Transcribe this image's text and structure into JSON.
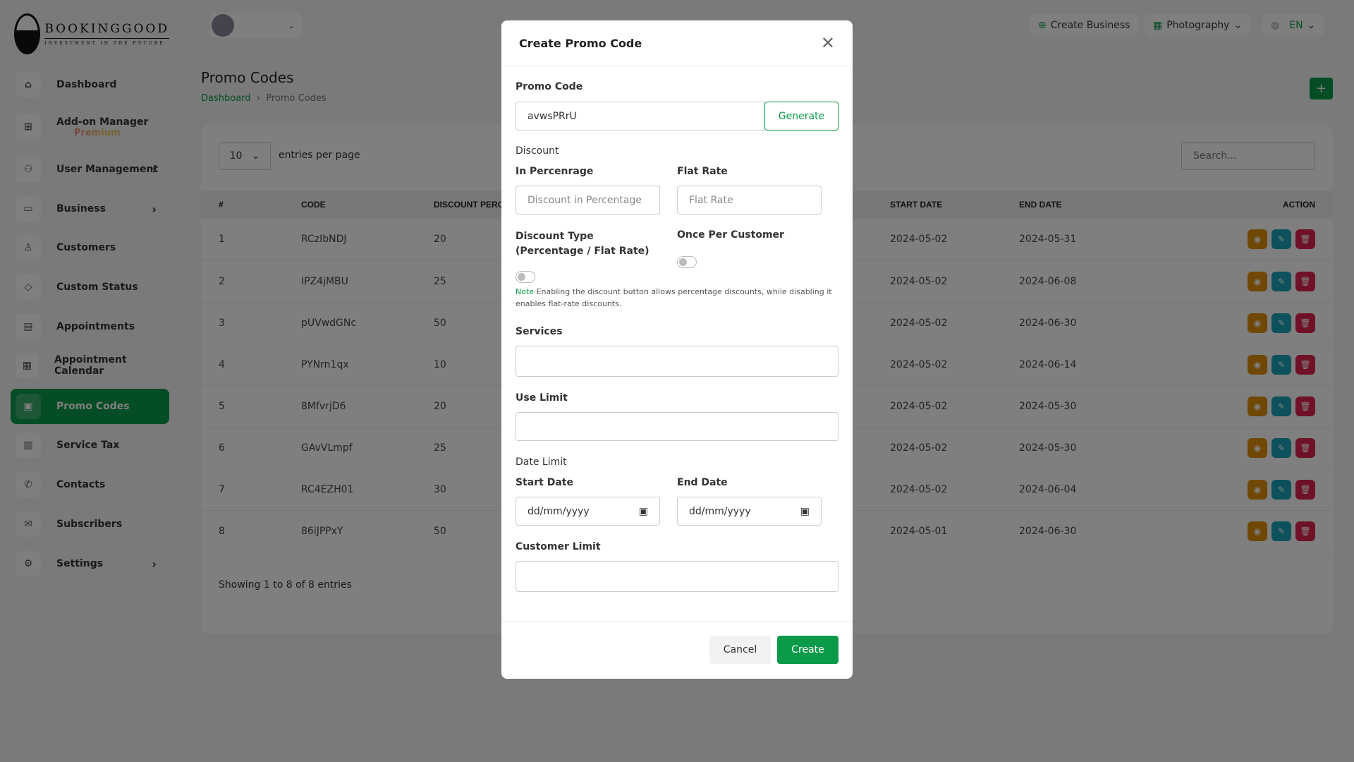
{
  "brand": {
    "name": "BOOKINGGOOD",
    "tagline": "INVESTMENT IN THE FUTURE"
  },
  "header": {
    "create_business": "Create Business",
    "category": "Photography",
    "language": "EN"
  },
  "sidebar": {
    "items": [
      {
        "label": "Dashboard",
        "icon": "home-icon"
      },
      {
        "label": "Add-on Manager",
        "badge": "Premium",
        "icon": "grid-icon"
      },
      {
        "label": "User Management",
        "icon": "users-icon",
        "chevron": true
      },
      {
        "label": "Business",
        "icon": "briefcase-icon",
        "chevron": true
      },
      {
        "label": "Customers",
        "icon": "user-icon"
      },
      {
        "label": "Custom Status",
        "icon": "tag-icon"
      },
      {
        "label": "Appointments",
        "icon": "card-icon"
      },
      {
        "label": "Appointment Calendar",
        "icon": "calendar-icon"
      },
      {
        "label": "Promo Codes",
        "icon": "ticket-icon",
        "active": true
      },
      {
        "label": "Service Tax",
        "icon": "receipt-icon"
      },
      {
        "label": "Contacts",
        "icon": "phone-icon"
      },
      {
        "label": "Subscribers",
        "icon": "mail-icon"
      },
      {
        "label": "Settings",
        "icon": "gear-icon",
        "chevron": true
      }
    ]
  },
  "page": {
    "title": "Promo Codes",
    "breadcrumb": [
      "Dashboard",
      "Promo Codes"
    ],
    "add_label": "+"
  },
  "table": {
    "per_page": "10",
    "per_page_label": "entries per page",
    "search_placeholder": "Search...",
    "columns": [
      "#",
      "CODE",
      "DISCOUNT PERCE",
      "START DATE",
      "END DATE",
      "ACTION"
    ],
    "rows": [
      [
        "1",
        "RCzIbNDJ",
        "20",
        "2024-05-02",
        "2024-05-31"
      ],
      [
        "2",
        "IPZ4jMBU",
        "25",
        "2024-05-02",
        "2024-06-08"
      ],
      [
        "3",
        "pUVwdGNc",
        "50",
        "2024-05-02",
        "2024-06-30"
      ],
      [
        "4",
        "PYNrn1qx",
        "10",
        "2024-05-02",
        "2024-06-14"
      ],
      [
        "5",
        "8MfvrjD6",
        "20",
        "2024-05-02",
        "2024-05-30"
      ],
      [
        "6",
        "GAvVLmpf",
        "25",
        "2024-05-02",
        "2024-05-30"
      ],
      [
        "7",
        "RC4EZH01",
        "30",
        "2024-05-02",
        "2024-06-04"
      ],
      [
        "8",
        "86iJPPxY",
        "50",
        "2024-05-01",
        "2024-06-30"
      ]
    ],
    "footer": "Showing 1 to 8 of 8 entries"
  },
  "modal": {
    "title": "Create Promo Code",
    "promo_label": "Promo Code",
    "promo_value": "avwsPRrU",
    "generate": "Generate",
    "discount": "Discount",
    "pct_label": "In Percenrage",
    "pct_placeholder": "Discount in Percentage",
    "flat_label": "Flat Rate",
    "flat_placeholder": "Flat Rate",
    "type_label": "Discount Type (Percentage / Flat Rate)",
    "once_label": "Once Per Customer",
    "note_prefix": "Note",
    "note": "Enabling the discount button allows percentage discounts, while disabling it enables flat-rate discounts.",
    "services": "Services",
    "use_limit": "Use Limit",
    "date_limit": "Date Limit",
    "start_date": "Start Date",
    "end_date": "End Date",
    "date_placeholder": "dd/mm/yyyy",
    "customer_limit": "Customer Limit",
    "cancel": "Cancel",
    "create": "Create"
  },
  "colors": {
    "accent": "#0a9a4a",
    "view": "#e0900a",
    "edit": "#1ba3b8",
    "delete": "#e0254f"
  }
}
